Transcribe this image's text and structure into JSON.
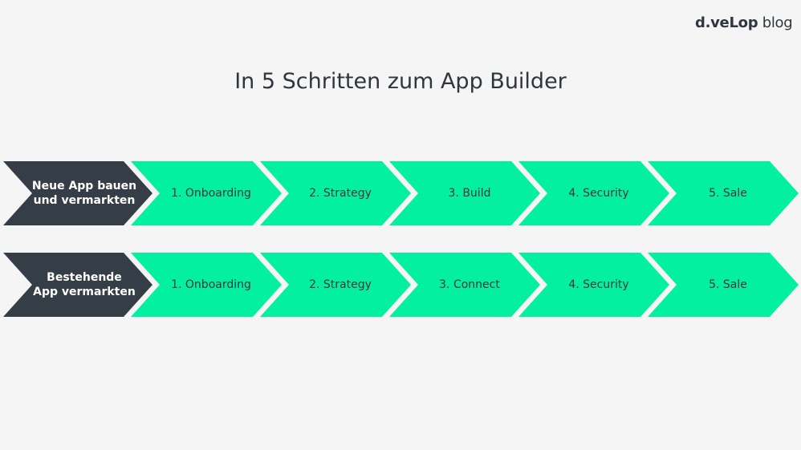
{
  "logo": {
    "brand": "d.veLop",
    "suffix": " blog"
  },
  "title": "In 5 Schritten zum App Builder",
  "colors": {
    "dark": "#353d47",
    "green": "#04f0a1",
    "background": "#f5f5f5",
    "text": "#2f3640"
  },
  "rows": [
    {
      "start_label_line1": "Neue App bauen",
      "start_label_line2": "und vermarkten",
      "steps": [
        "1. Onboarding",
        "2. Strategy",
        "3. Build",
        "4. Security",
        "5. Sale"
      ]
    },
    {
      "start_label_line1": "Bestehende",
      "start_label_line2": "App vermarkten",
      "steps": [
        "1. Onboarding",
        "2. Strategy",
        "3. Connect",
        "4. Security",
        "5. Sale"
      ]
    }
  ]
}
